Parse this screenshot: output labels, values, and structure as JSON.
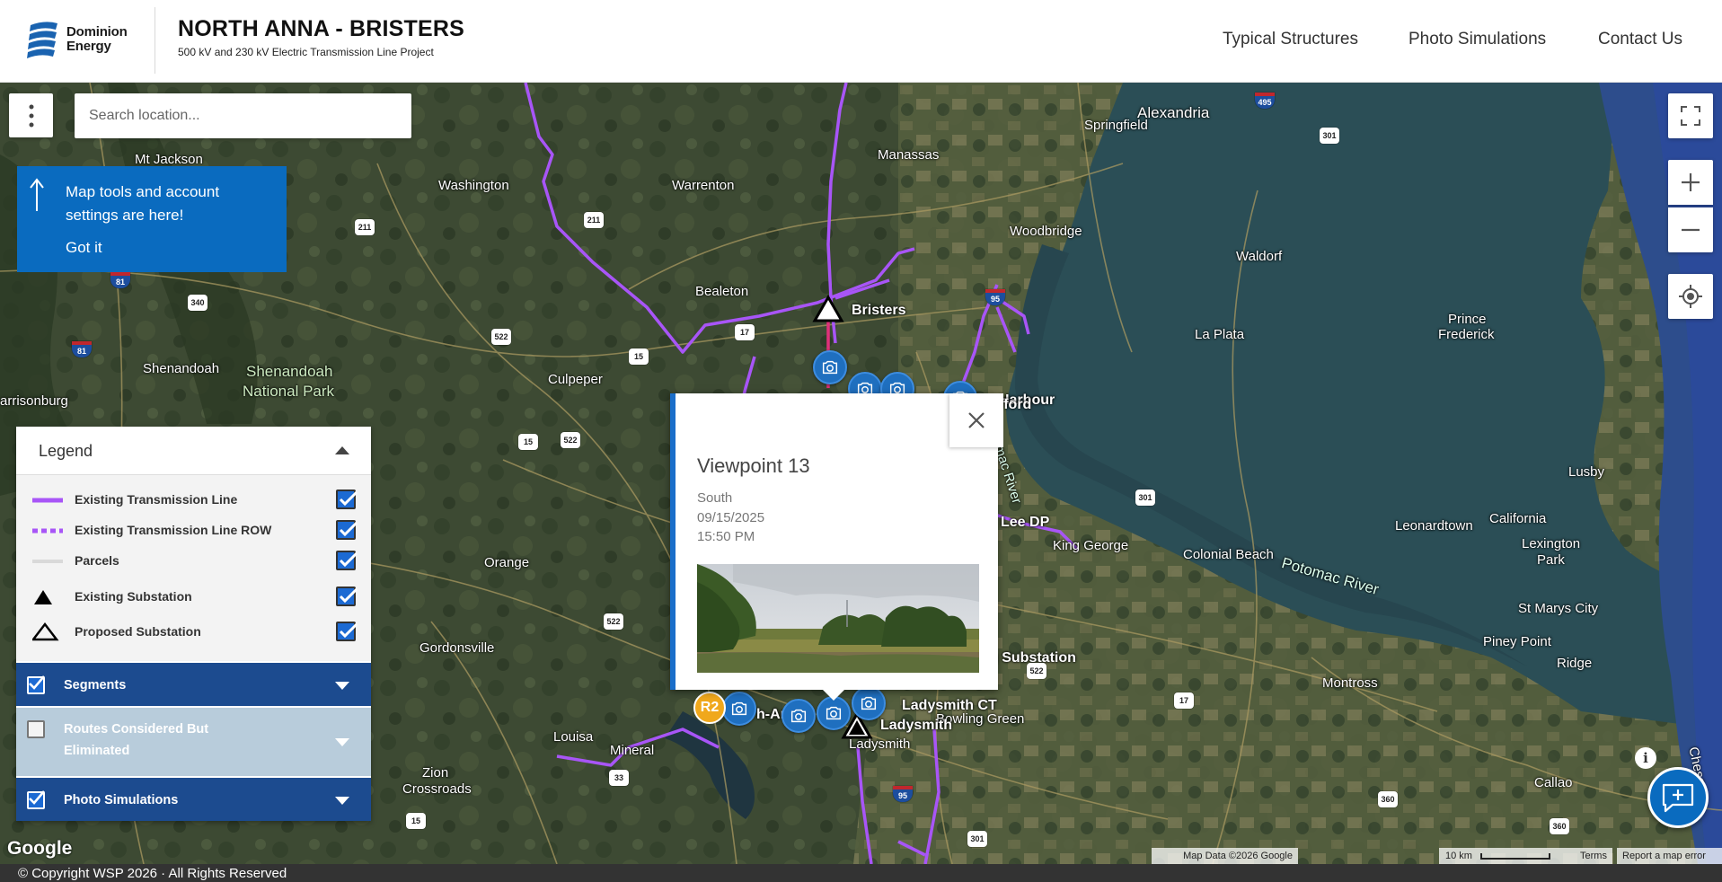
{
  "header": {
    "logo_text": "Dominion Energy",
    "logo_line1": "Dominion",
    "logo_line2": "Energy",
    "project_title": "NORTH ANNA - BRISTERS",
    "project_subtitle": "500 kV and 230 kV Electric Transmission Line Project",
    "nav": [
      "Typical Structures",
      "Photo Simulations",
      "Contact Us"
    ]
  },
  "search": {
    "placeholder": "Search location..."
  },
  "tooltip": {
    "message": "Map tools and account settings are here!",
    "button": "Got it"
  },
  "legend": {
    "title": "Legend",
    "items": [
      {
        "label": "Existing Transmission Line",
        "symbol": "solid-line",
        "color": "#a855f7",
        "checked": true
      },
      {
        "label": "Existing Transmission Line ROW",
        "symbol": "dashed-line",
        "color": "#a855f7",
        "checked": true
      },
      {
        "label": "Parcels",
        "symbol": "light-line",
        "color": "#d9d9d9",
        "checked": true
      },
      {
        "label": "Existing Substation",
        "symbol": "filled-triangle",
        "color": "#000000",
        "checked": true
      },
      {
        "label": "Proposed Substation",
        "symbol": "outline-triangle",
        "color": "#000000",
        "checked": true
      }
    ],
    "sections": [
      {
        "label": "Segments",
        "checked": true
      },
      {
        "label_line1": "Routes Considered But",
        "label_line2": "Eliminated",
        "checked": false
      },
      {
        "label": "Photo Simulations",
        "checked": true
      }
    ]
  },
  "popup": {
    "title": "Viewpoint 13",
    "direction": "South",
    "date": "09/15/2025",
    "time": "15:50 PM"
  },
  "map": {
    "places": [
      "Alexandria",
      "Springfield",
      "Manassas",
      "Mt Jackson",
      "Washington",
      "Warrenton",
      "Woodbridge",
      "Waldorf",
      "Bealeton",
      "Bristers",
      "Prince",
      "Frederick",
      "La Plata",
      "Shenandoah",
      "Shenandoah",
      "National Park",
      "Culpeper",
      "arrisonburg",
      "Lusby",
      "Leonardtown",
      "California",
      "Lexington",
      "Park",
      "Colonial Beach",
      "King George",
      "Lee DP",
      "Orange",
      "Gordonsville",
      "St Marys City",
      "Piney Point",
      "Ridge",
      "Montross",
      "Bowling Green",
      "Ladysmith CT",
      "Ladysmith",
      "Ladysmith",
      "Louisa",
      "Mineral",
      "Zion",
      "Crossroads",
      "Callao",
      "g Substation",
      "Harbour",
      "afford",
      "h-An",
      "Potomac River",
      "Potomac River",
      "Chesa"
    ],
    "marker_badge": "R2",
    "road_shields": [
      "495",
      "301",
      "211",
      "81",
      "340",
      "81",
      "522",
      "15",
      "17",
      "95",
      "522",
      "15",
      "522",
      "301",
      "522",
      "17",
      "33",
      "95",
      "301",
      "360",
      "360",
      "15",
      "211"
    ]
  },
  "attribution": {
    "map_data": "Map Data ©2026 Google",
    "scale": "10 km",
    "terms": "Terms",
    "report": "Report a map error",
    "google": "Google"
  },
  "footer": {
    "copyright": "© Copyright WSP 2026 · All Rights Reserved"
  },
  "colors": {
    "brand_blue": "#0a6bbf",
    "legend_section": "#1c4b8f",
    "transmission": "#a855f7",
    "substation_pink": "#e0307a"
  }
}
